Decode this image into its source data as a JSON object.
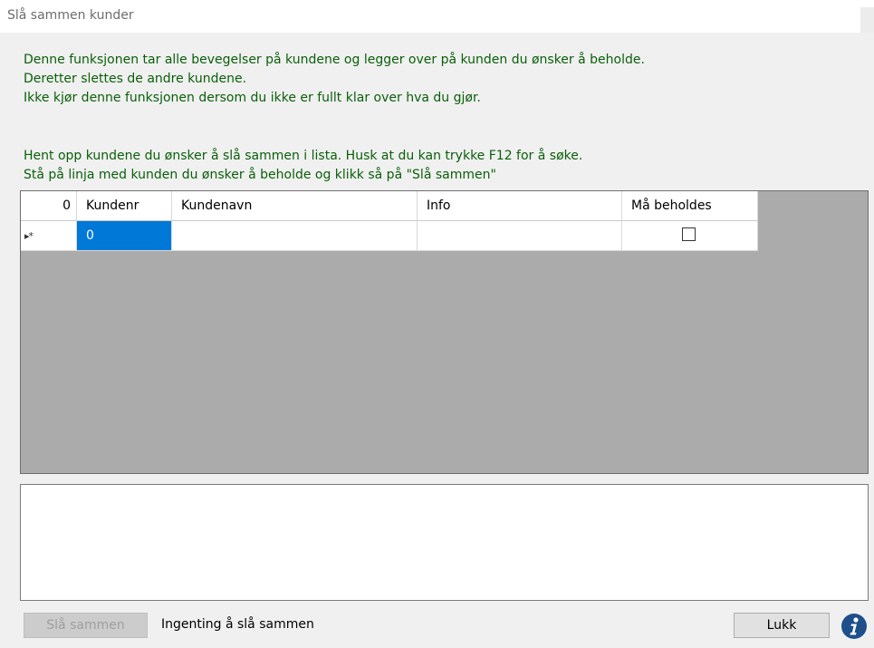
{
  "window": {
    "title": "Slå sammen kunder"
  },
  "description": {
    "line1": "Denne funksjonen tar alle bevegelser på kundene og legger over på kunden du ønsker å beholde.",
    "line2": "Deretter slettes de andre kundene.",
    "line3": "Ikke kjør denne funksjonen dersom du ikke er fullt klar over hva du gjør.",
    "line4": "Hent opp kundene du ønsker å slå sammen i lista. Husk at du kan trykke F12 for å søke.",
    "line5": "Stå på linja med kunden du ønsker å beholde og klikk så på \"Slå sammen\""
  },
  "grid": {
    "row_count_header": "0",
    "columns": [
      "Kundenr",
      "Kundenavn",
      "Info",
      "Må beholdes"
    ],
    "new_row": {
      "marker": "▸*",
      "kundenr": "0",
      "kundenavn": "",
      "info": "",
      "maa_beholdes": false
    }
  },
  "memo": {
    "value": ""
  },
  "footer": {
    "merge_label": "Slå sammen",
    "merge_enabled": false,
    "status": "Ingenting å slå sammen",
    "close_label": "Lukk",
    "info_icon": "info-icon"
  },
  "colors": {
    "description_text": "#0a5f0a",
    "selection": "#0078d7",
    "grid_background": "#ababab",
    "info_icon": "#1d4f8b"
  }
}
